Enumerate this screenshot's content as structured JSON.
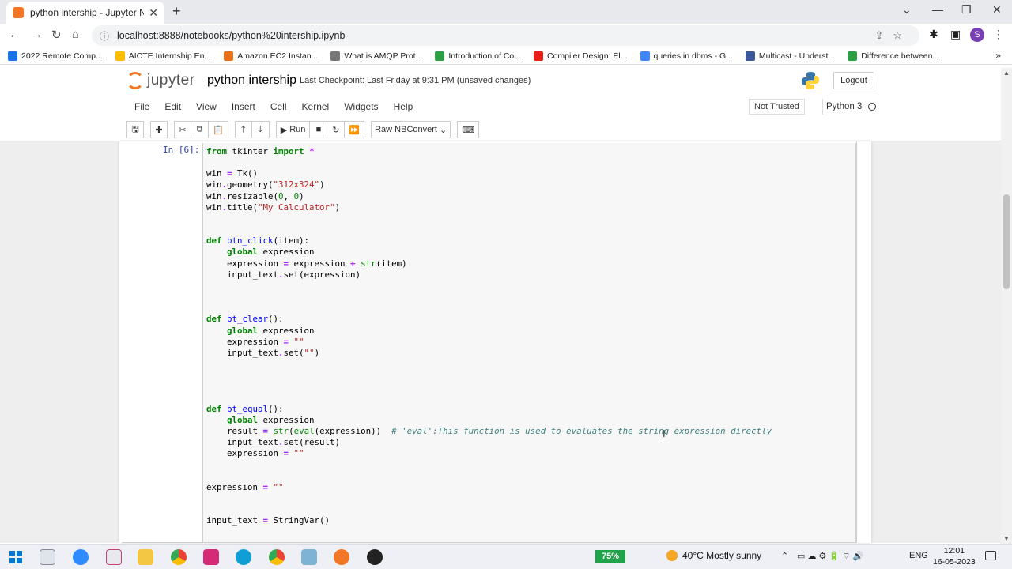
{
  "browser": {
    "tab_title": "python intership - Jupyter Noteb",
    "tab_close": "✕",
    "new_tab": "+",
    "url": "localhost:8888/notebooks/python%20intership.ipynb",
    "window_controls": [
      "⌄",
      "—",
      "❐",
      "✕"
    ],
    "avatar_letter": "S",
    "bookmarks": [
      {
        "label": "2022 Remote Comp...",
        "color": "#1a73e8"
      },
      {
        "label": "AICTE Internship En...",
        "color": "#fbbc04"
      },
      {
        "label": "Amazon EC2 Instan...",
        "color": "#e8711a"
      },
      {
        "label": "What is AMQP Prot...",
        "color": "#777777"
      },
      {
        "label": "Introduction of Co...",
        "color": "#2e9e44"
      },
      {
        "label": "Compiler Design: El...",
        "color": "#e62117"
      },
      {
        "label": "queries in dbms - G...",
        "color": "#4285f4"
      },
      {
        "label": "Multicast - Underst...",
        "color": "#3b5998"
      },
      {
        "label": "Difference between...",
        "color": "#2e9e44"
      }
    ]
  },
  "jupyter": {
    "logo_text": "jupyter",
    "notebook_name": "python intership",
    "checkpoint": "Last Checkpoint: Last Friday at 9:31 PM  (unsaved changes)",
    "logout": "Logout",
    "menu": [
      "File",
      "Edit",
      "View",
      "Insert",
      "Cell",
      "Kernel",
      "Widgets",
      "Help"
    ],
    "trust": "Not Trusted",
    "kernel_name": "Python 3",
    "run_label": "Run",
    "cell_type": "Raw NBConvert"
  },
  "cell": {
    "prompt": "In [6]:"
  },
  "taskbar": {
    "battery": "75%",
    "weather": "40°C  Mostly sunny",
    "lang": "ENG",
    "time": "12:01",
    "date": "16-05-2023"
  }
}
